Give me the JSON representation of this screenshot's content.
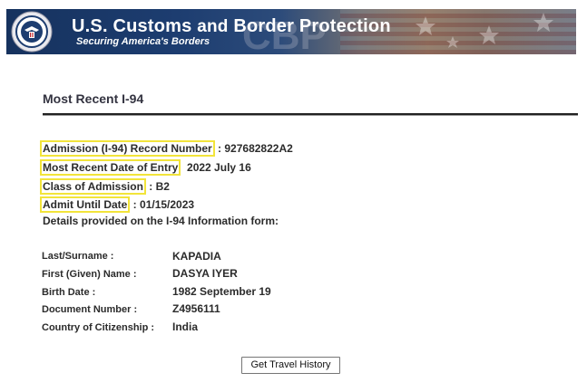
{
  "header": {
    "title_main": "U.S. Customs ",
    "title_and": "and",
    "title_rest": " Border Protection",
    "subtitle": "Securing America's Borders",
    "seal_icon": "cbp-seal-icon",
    "brand_color": "#1d3d70"
  },
  "page_title": "Most Recent I-94",
  "summary": [
    {
      "label": "Admission (I-94) Record Number",
      "sep": " : ",
      "value": "927682822A2"
    },
    {
      "label": "Most Recent Date of Entry",
      "sep": "  ",
      "value": "2022 July 16"
    },
    {
      "label": "Class of Admission",
      "sep": " : ",
      "value": "B2"
    },
    {
      "label": "Admit Until Date",
      "sep": " : ",
      "value": "01/15/2023"
    }
  ],
  "note": "Details provided on the I-94 Information form:",
  "details": [
    {
      "label": "Last/Surname :",
      "value": "KAPADIA"
    },
    {
      "label": "First (Given) Name :",
      "value": "DASYA IYER"
    },
    {
      "label": "Birth Date :",
      "value": "1982 September 19"
    },
    {
      "label": "Document Number :",
      "value": "Z4956111"
    },
    {
      "label": "Country of Citizenship :",
      "value": "India"
    }
  ],
  "travel_history_button": "Get Travel History",
  "highlight_color": "#f2e43a"
}
